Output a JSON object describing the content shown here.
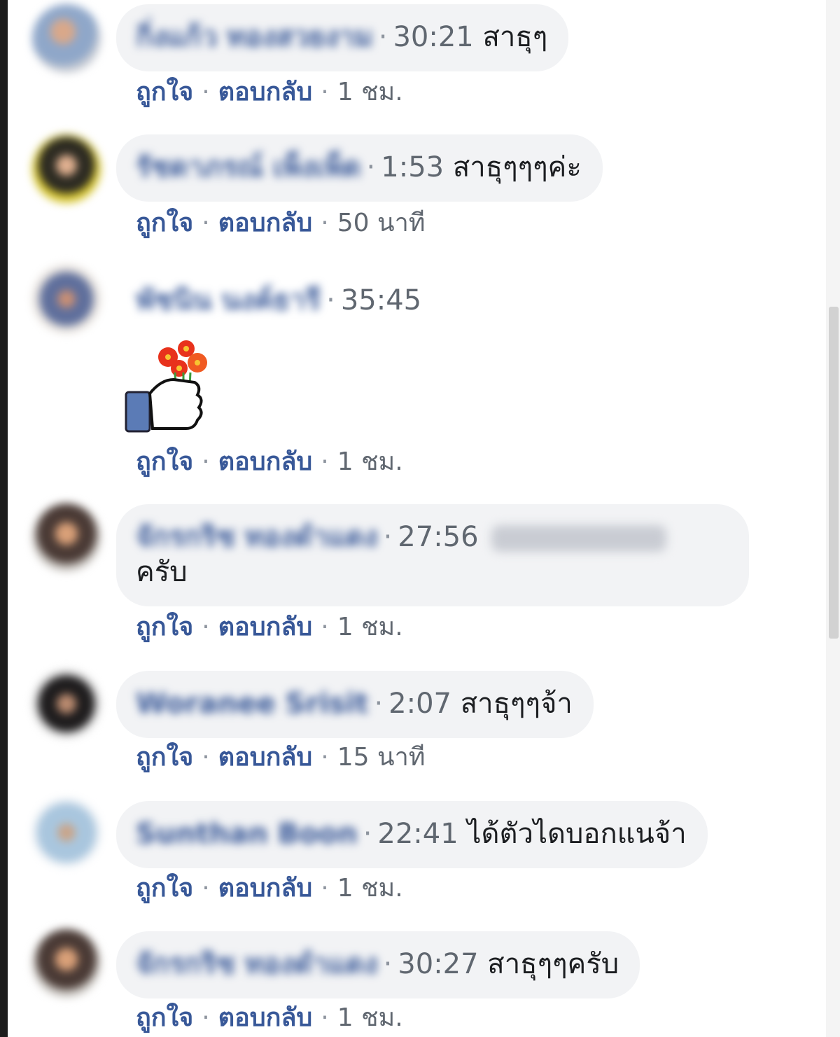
{
  "comments": [
    {
      "author": "กิ่งแก้ว ทองสวยงาม",
      "time": "30:21",
      "text": "สาธุๆ",
      "like_label": "ถูกใจ",
      "reply_label": "ตอบกลับ",
      "ago": "1 ชม."
    },
    {
      "author": "รัชดาภรณ์ เพ็งเพ็ด",
      "time": "1:53",
      "text": "สาธุๆๆๆค่ะ",
      "like_label": "ถูกใจ",
      "reply_label": "ตอบกลับ",
      "ago": "50 นาที"
    },
    {
      "author": "พัชนิน นงค์ธารี",
      "time": "35:45",
      "sticker": "flower-bouquet-thumb-sticker",
      "like_label": "ถูกใจ",
      "reply_label": "ตอบกลับ",
      "ago": "1 ชม."
    },
    {
      "author": "จักรกริช ทองดำแดง",
      "time": "27:56",
      "text_line2": "ครับ",
      "like_label": "ถูกใจ",
      "reply_label": "ตอบกลับ",
      "ago": "1 ชม."
    },
    {
      "author": "Woranee Srisit",
      "time": "2:07",
      "text": "สาธุๆๆจ้า",
      "like_label": "ถูกใจ",
      "reply_label": "ตอบกลับ",
      "ago": "15 นาที"
    },
    {
      "author": "Sunthan Boon",
      "time": "22:41",
      "text": "ได้ตัวไดบอกแนจ้า",
      "like_label": "ถูกใจ",
      "reply_label": "ตอบกลับ",
      "ago": "1 ชม."
    },
    {
      "author": "จักรกริช ทองดำแดง",
      "time": "30:27",
      "text": "สาธุๆๆครับ",
      "like_label": "ถูกใจ",
      "reply_label": "ตอบกลับ",
      "ago": "1 ชม."
    }
  ],
  "separator": "·",
  "colors": {
    "bubble": "#f2f3f5",
    "link": "#385898",
    "meta": "#606770",
    "text": "#1c1e21"
  }
}
